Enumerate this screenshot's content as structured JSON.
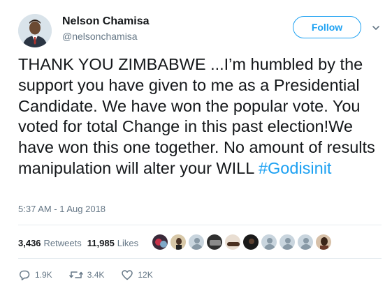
{
  "user": {
    "name": "Nelson Chamisa",
    "handle": "@nelsonchamisa"
  },
  "header": {
    "follow_label": "Follow",
    "more_icon": "chevron-down-icon"
  },
  "tweet": {
    "text_main": "THANK YOU ZIMBABWE ...I’m humbled by the support you have given to me as a Presidential Candidate. We have won the popular vote. You voted for total Change in this past election!We have won this one together. No amount of results manipulation will alter your WILL ",
    "hashtag": "#Godisinit",
    "timestamp": "5:37 AM - 1 Aug 2018"
  },
  "stats": {
    "retweets_count": "3,436",
    "retweets_label": "Retweets",
    "likes_count": "11,985",
    "likes_label": "Likes"
  },
  "actions": {
    "reply_count": "1.9K",
    "retweet_count": "3.4K",
    "like_count": "12K"
  },
  "colors": {
    "accent": "#1da1f2",
    "secondary_text": "#657786",
    "divider": "#e6ecf0"
  }
}
